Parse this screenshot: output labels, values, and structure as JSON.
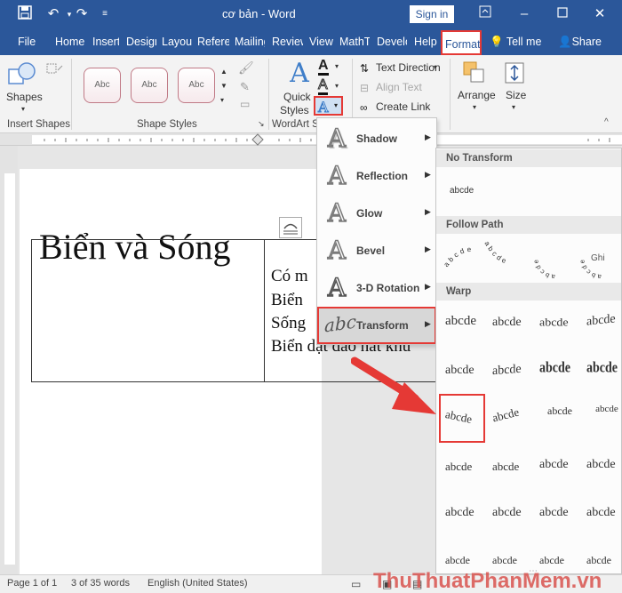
{
  "window": {
    "title": "cơ bản  -  Word",
    "signin_label": "Sign in"
  },
  "tabs": [
    "File",
    "Home",
    "Insert",
    "Design",
    "Layout",
    "References",
    "Mailings",
    "Review",
    "View",
    "MathType",
    "Developer",
    "Help",
    "Format"
  ],
  "active_tab": "Format",
  "tell_me": "Tell me",
  "share": "Share",
  "ribbon": {
    "shapes_label": "Shapes",
    "insert_shapes_label": "Insert Shapes",
    "style_sample": "Abc",
    "shape_styles_label": "Shape Styles",
    "quick_styles_line1": "Quick",
    "quick_styles_line2": "Styles",
    "wordart_label": "WordArt S",
    "text_direction": "Text Direction",
    "align_text": "Align Text",
    "create_link": "Create Link",
    "arrange": "Arrange",
    "size": "Size"
  },
  "document": {
    "heading": "Biển và Sóng",
    "lines": [
      "Có m",
      "Biển",
      "Sống",
      "Biển dạt dào hát khú"
    ]
  },
  "menu": {
    "items": [
      {
        "label": "Shadow"
      },
      {
        "label": "Reflection"
      },
      {
        "label": "Glow"
      },
      {
        "label": "Bevel"
      },
      {
        "label": "3-D Rotation"
      },
      {
        "label": "Transform"
      }
    ],
    "icon_letter": "A",
    "transform_icon_text": "abc"
  },
  "submenu": {
    "no_transform_header": "No Transform",
    "no_transform_sample": "abcde",
    "follow_path_header": "Follow Path",
    "warp_header": "Warp",
    "warp_sample": "abcde"
  },
  "status": {
    "page": "Page 1 of 1",
    "words": "3 of 35 words",
    "language": "English (United States)"
  },
  "watermark": "ThuThuatPhanMem.vn",
  "colors": {
    "accent": "#2b579a",
    "highlight": "#e53935"
  }
}
